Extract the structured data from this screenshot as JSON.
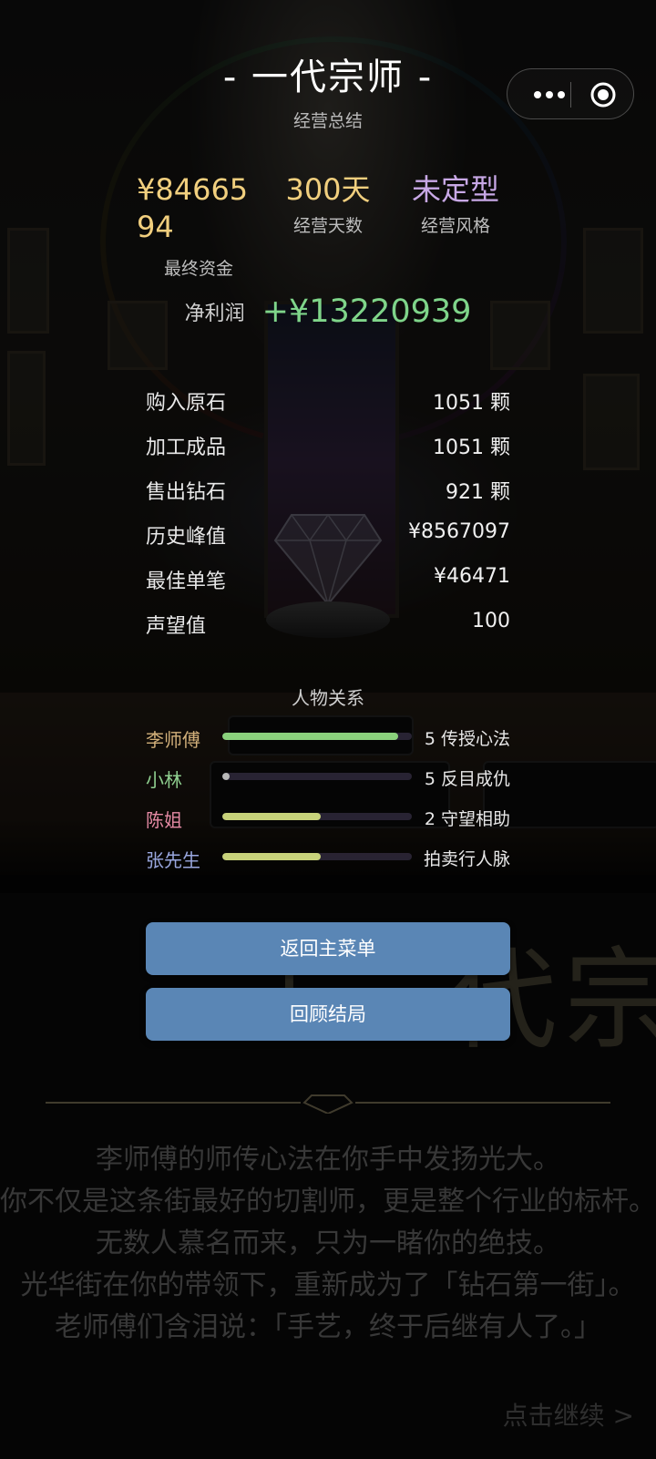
{
  "header": {
    "title": "- 一代宗师 -",
    "subtitle": "经营总结"
  },
  "stats": {
    "final_money": {
      "value": "¥8466594",
      "label": "最终资金"
    },
    "days": {
      "value": "300天",
      "label": "经营天数"
    },
    "style": {
      "value": "未定型",
      "label": "经营风格"
    }
  },
  "profit": {
    "label": "净利润",
    "value": "+¥13220939"
  },
  "rows": [
    {
      "label": "购入原石",
      "value": "1051 颗"
    },
    {
      "label": "加工成品",
      "value": "1051 颗"
    },
    {
      "label": "售出钻石",
      "value": "921 颗"
    },
    {
      "label": "历史峰值",
      "value": "¥8567097"
    },
    {
      "label": "最佳单笔",
      "value": "¥46471"
    },
    {
      "label": "声望值",
      "value": "100"
    }
  ],
  "relations": {
    "title": "人物关系",
    "items": [
      {
        "name": "李师傅",
        "status": "5 传授心法",
        "level": 0.93,
        "name_color": "#d2b07a",
        "bar_color": "#8ad17c"
      },
      {
        "name": "小林",
        "status": "5 反目成仇",
        "level": 0.04,
        "name_color": "#8fcf8f",
        "bar_color": "#b8b8b8"
      },
      {
        "name": "陈姐",
        "status": "2 守望相助",
        "level": 0.52,
        "name_color": "#e58aa4",
        "bar_color": "#c7d27a"
      },
      {
        "name": "张先生",
        "status": "拍卖行人脉",
        "level": 0.52,
        "name_color": "#9aa8e0",
        "bar_color": "#c7d27a"
      }
    ]
  },
  "buttons": {
    "main_menu": "返回主菜单",
    "review": "回顾结局"
  },
  "story": {
    "title_glyphs": "「一代宗师」",
    "lines": [
      "李师傅的师传心法在你手中发扬光大。",
      "你不仅是这条街最好的切割师，更是整个行业的标杆。",
      "无数人慕名而来，只为一睹你的绝技。",
      "光华街在你的带领下，重新成为了「钻石第一街」。",
      "老师傅们含泪说：「手艺，终于后继有人了。」"
    ],
    "continue": "点击继续 >"
  },
  "capsule": {
    "menu_icon": "more-dots-icon",
    "close_icon": "target-icon"
  }
}
